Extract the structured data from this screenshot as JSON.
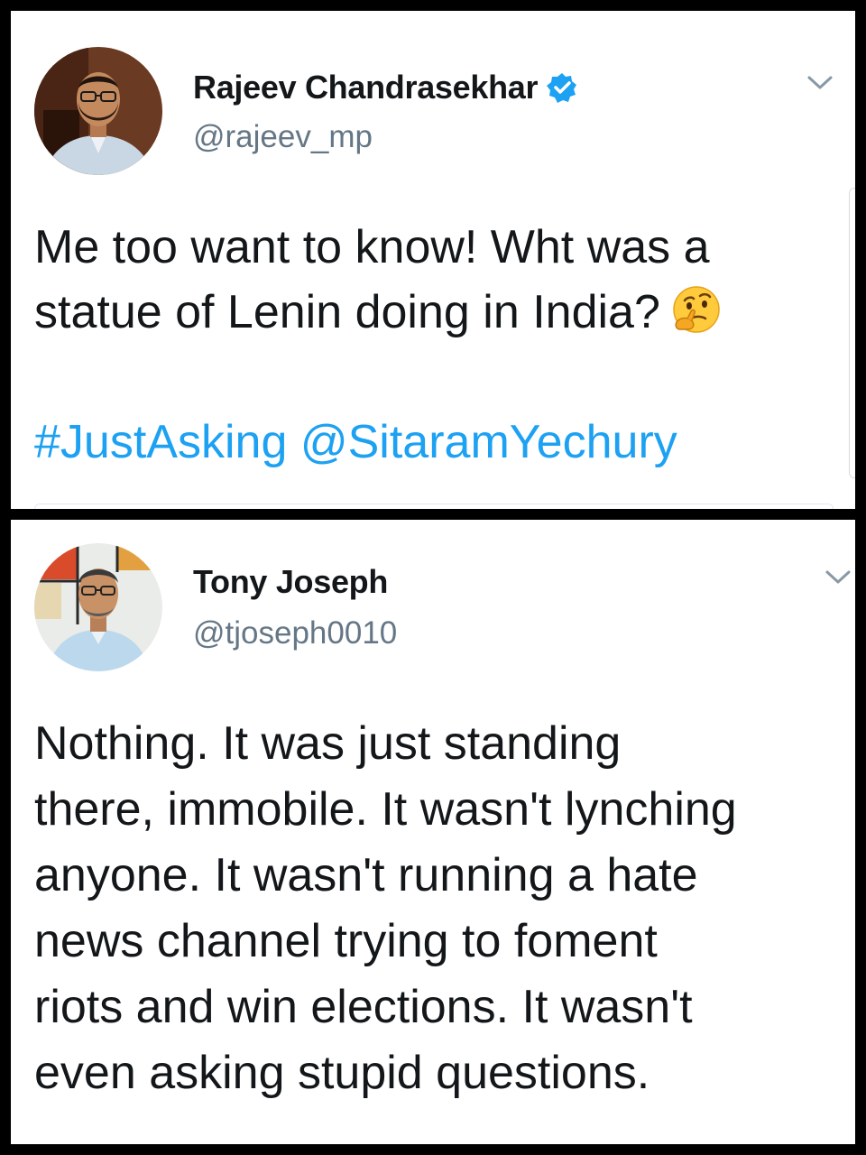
{
  "tweets": [
    {
      "author": {
        "name": "Rajeev Chandrasekhar",
        "handle": "@rajeev_mp",
        "verified": true,
        "avatar_icon": "profile-photo"
      },
      "text": "Me too want to know! Wht was a\nstatue of Lenin doing in India?",
      "emoji": "thinking-face-emoji",
      "hashtag": "#JustAsking",
      "mention": "@SitaramYechury"
    },
    {
      "author": {
        "name": "Tony Joseph",
        "handle": "@tjoseph0010",
        "verified": false,
        "avatar_icon": "profile-photo"
      },
      "text": "Nothing. It was just standing\nthere, immobile. It wasn't lynching\nanyone. It wasn't running a hate\nnews channel trying to foment\nriots and win elections. It wasn't\neven asking stupid questions."
    }
  ],
  "colors": {
    "link": "#1da1f2",
    "text": "#14171a",
    "secondary": "#657786",
    "frame": "#000000"
  },
  "icons": {
    "verified": "verified-badge-icon",
    "menu": "chevron-down-icon"
  }
}
